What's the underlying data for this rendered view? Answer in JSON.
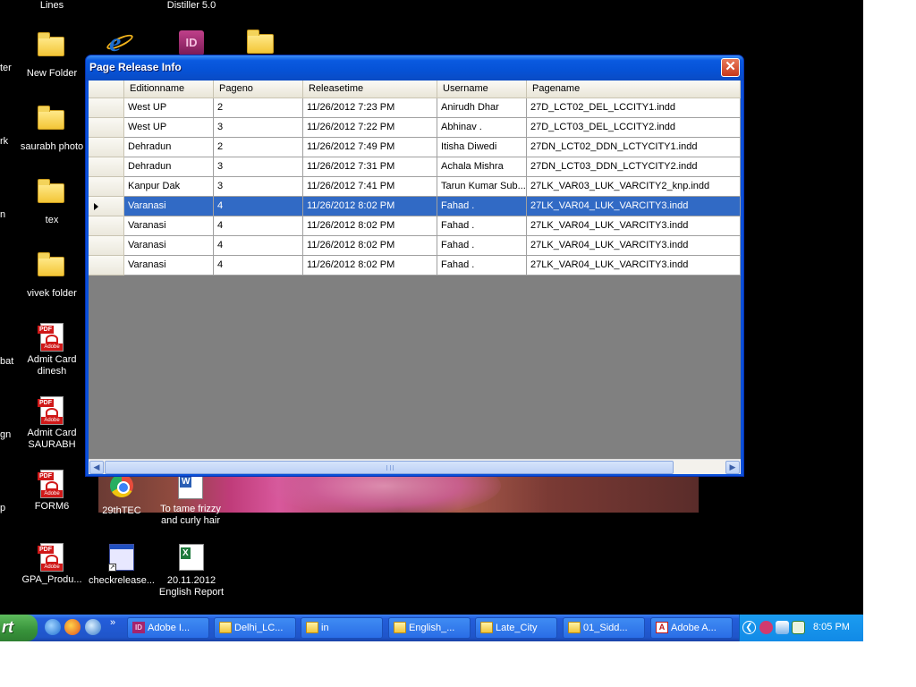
{
  "desktop": {
    "cut_labels": [
      "ter",
      "rk",
      "n",
      "bat",
      "gn",
      "p"
    ],
    "icons": [
      {
        "label": "Lines",
        "icon": "folder-icon"
      },
      {
        "label": "Distiller 5.0",
        "icon": "acrobat-distiller-icon"
      },
      {
        "label": "New Folder",
        "icon": "folder-icon"
      },
      {
        "label": "saurabh photo",
        "icon": "folder-icon"
      },
      {
        "label": "tex",
        "icon": "folder-icon"
      },
      {
        "label": "vivek folder",
        "icon": "folder-icon"
      },
      {
        "label": "Admit Card dinesh",
        "icon": "pdf-icon"
      },
      {
        "label": "Admit Card SAURABH",
        "icon": "pdf-icon"
      },
      {
        "label": "FORM6",
        "icon": "pdf-icon"
      },
      {
        "label": "29thTEC",
        "icon": "image-icon"
      },
      {
        "label": "To tame frizzy and curly hair",
        "icon": "word-document-icon"
      },
      {
        "label": "GPA_Produ...",
        "icon": "pdf-icon"
      },
      {
        "label": "checkrelease...",
        "icon": "application-shortcut-icon"
      },
      {
        "label": "20.11.2012 English Report",
        "icon": "excel-document-icon"
      }
    ]
  },
  "window": {
    "title": "Page Release Info",
    "close_symbol": "✕",
    "columns": [
      "Editionname",
      "Pageno",
      "Releasetime",
      "Username",
      "Pagename"
    ],
    "rows": [
      [
        "West UP",
        "2",
        "11/26/2012 7:23 PM",
        "Anirudh Dhar",
        "27D_LCT02_DEL_LCCITY1.indd"
      ],
      [
        "West UP",
        "3",
        "11/26/2012 7:22 PM",
        "Abhinav .",
        "27D_LCT03_DEL_LCCITY2.indd"
      ],
      [
        "Dehradun",
        "2",
        "11/26/2012 7:49 PM",
        "Itisha Diwedi",
        "27DN_LCT02_DDN_LCTYCITY1.indd"
      ],
      [
        "Dehradun",
        "3",
        "11/26/2012 7:31 PM",
        "Achala Mishra",
        "27DN_LCT03_DDN_LCTYCITY2.indd"
      ],
      [
        "Kanpur Dak",
        "3",
        "11/26/2012 7:41 PM",
        "Tarun Kumar Sub...",
        "27LK_VAR03_LUK_VARCITY2_knp.indd"
      ],
      [
        "Varanasi",
        "4",
        "11/26/2012 8:02 PM",
        "Fahad .",
        "27LK_VAR04_LUK_VARCITY3.indd"
      ],
      [
        "Varanasi",
        "4",
        "11/26/2012 8:02 PM",
        "Fahad .",
        "27LK_VAR04_LUK_VARCITY3.indd"
      ],
      [
        "Varanasi",
        "4",
        "11/26/2012 8:02 PM",
        "Fahad .",
        "27LK_VAR04_LUK_VARCITY3.indd"
      ],
      [
        "Varanasi",
        "4",
        "11/26/2012 8:02 PM",
        "Fahad .",
        "27LK_VAR04_LUK_VARCITY3.indd"
      ]
    ],
    "selected_row": 5,
    "scroll_left": "◀",
    "scroll_right": "▶"
  },
  "taskbar": {
    "start_label": "rt",
    "quicklaunch_more": "»",
    "tasks": [
      {
        "label": "Adobe I...",
        "icon": "indesign-icon"
      },
      {
        "label": "Delhi_LC...",
        "icon": "folder-icon"
      },
      {
        "label": "in",
        "icon": "folder-icon"
      },
      {
        "label": "English_...",
        "icon": "folder-icon"
      },
      {
        "label": "Late_City",
        "icon": "folder-icon"
      },
      {
        "label": "01_Sidd...",
        "icon": "folder-icon"
      },
      {
        "label": "Adobe A...",
        "icon": "acrobat-icon"
      }
    ],
    "tray_chevron": "❮",
    "clock": "8:05 PM"
  }
}
